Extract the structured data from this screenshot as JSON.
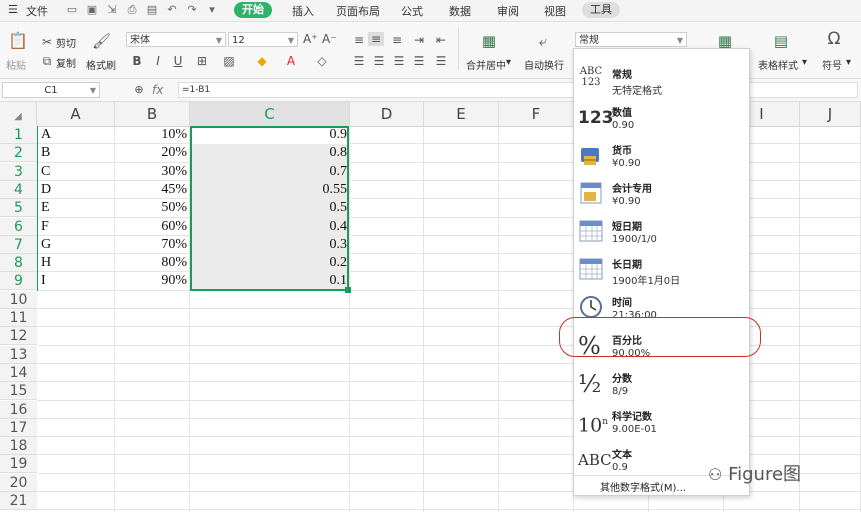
{
  "menubar": {
    "file": "文件",
    "tabs": [
      "开始",
      "插入",
      "页面布局",
      "公式",
      "数据",
      "审阅",
      "视图"
    ],
    "tools": "工具"
  },
  "ribbon": {
    "paste": "粘贴",
    "cut": "剪切",
    "copy": "复制",
    "format_painter": "格式刷",
    "font_name": "宋体",
    "font_size": "12",
    "merge_center": "合并居中",
    "wrap_text": "自动换行",
    "number_format": "常规",
    "table_style": "表格样式",
    "symbol": "符号"
  },
  "formula_bar": {
    "name_box": "C1",
    "fx": "fx",
    "formula": "=1-B1"
  },
  "grid": {
    "columns": [
      "A",
      "B",
      "C",
      "D",
      "E",
      "F",
      "G",
      "H",
      "I",
      "J"
    ],
    "rows": [
      "1",
      "2",
      "3",
      "4",
      "5",
      "6",
      "7",
      "8",
      "9",
      "10",
      "11",
      "12",
      "13",
      "14",
      "15",
      "16",
      "17",
      "18",
      "19",
      "20",
      "21"
    ],
    "col_a": [
      "A",
      "B",
      "C",
      "D",
      "E",
      "F",
      "G",
      "H",
      "I"
    ],
    "col_b": [
      "10%",
      "20%",
      "30%",
      "45%",
      "50%",
      "60%",
      "70%",
      "80%",
      "90%"
    ],
    "col_c": [
      "0.9",
      "0.8",
      "0.7",
      "0.55",
      "0.5",
      "0.4",
      "0.3",
      "0.2",
      "0.1"
    ]
  },
  "number_format_menu": {
    "items": [
      {
        "icon": "abc-123-icon",
        "icon_text": "ABC\n123",
        "name": "常规",
        "example": "无特定格式"
      },
      {
        "icon": "number-123-icon",
        "icon_text": "123",
        "name": "数值",
        "example": "0.90"
      },
      {
        "icon": "coins-icon",
        "name": "货币",
        "example": "¥0.90"
      },
      {
        "icon": "accounting-icon",
        "name": "会计专用",
        "example": "¥0.90"
      },
      {
        "icon": "calendar-short-icon",
        "name": "短日期",
        "example": "1900/1/0"
      },
      {
        "icon": "calendar-long-icon",
        "name": "长日期",
        "example": "1900年1月0日"
      },
      {
        "icon": "clock-icon",
        "name": "时间",
        "example": "21:36:00"
      },
      {
        "icon": "percent-icon",
        "icon_text": "%",
        "name": "百分比",
        "example": "90.00%"
      },
      {
        "icon": "fraction-icon",
        "icon_text": "½",
        "name": "分数",
        "example": "8/9"
      },
      {
        "icon": "scientific-icon",
        "icon_text": "10ⁿ",
        "name": "科学记数",
        "example": "9.00E-01"
      },
      {
        "icon": "text-abc-icon",
        "icon_text": "ABC",
        "name": "文本",
        "example": "0.9"
      }
    ],
    "more": "其他数字格式(M)..."
  },
  "watermark": "Figure图",
  "colors": {
    "accent": "#2fb36b",
    "selection": "#1e9a58",
    "callout": "#c9302c"
  }
}
